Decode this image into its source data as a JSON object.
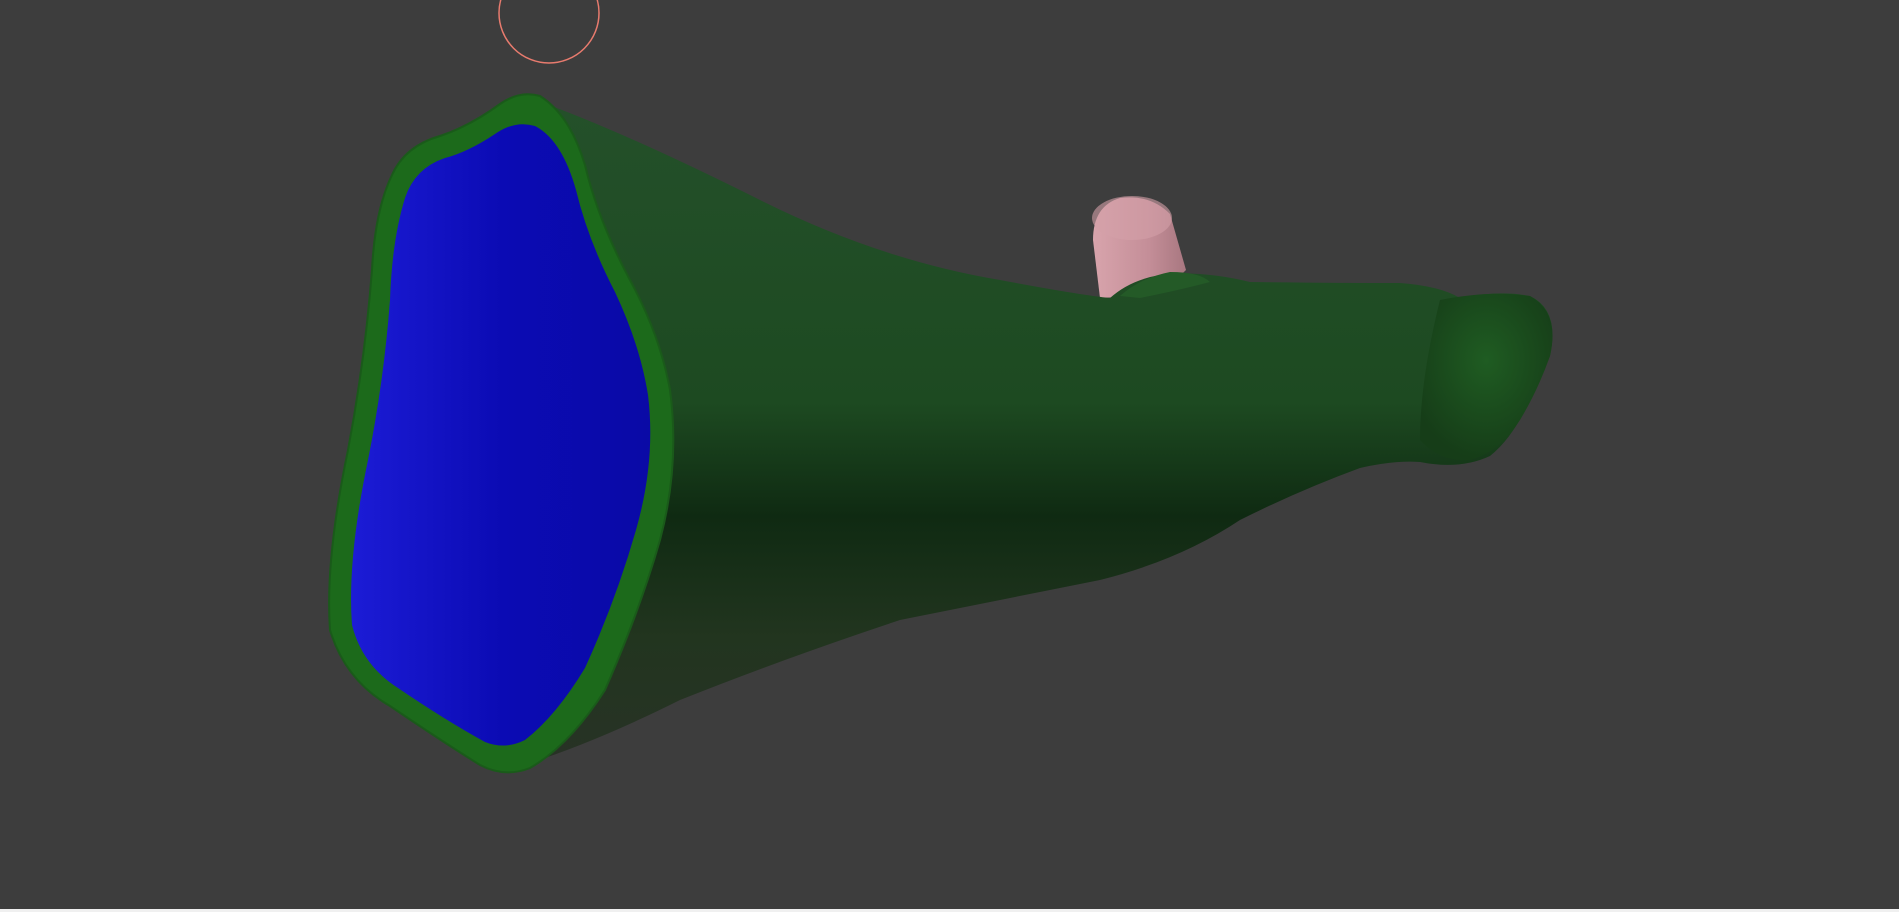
{
  "viewport": {
    "background_color": "#3d3d3d",
    "brush_cursor_color": "#e87b6e"
  },
  "mesh": {
    "outer_color": "#1f4a22",
    "rim_color": "#1d6b1c",
    "cap_color": "#0c0cb8",
    "stub_color": "#c8929c"
  }
}
